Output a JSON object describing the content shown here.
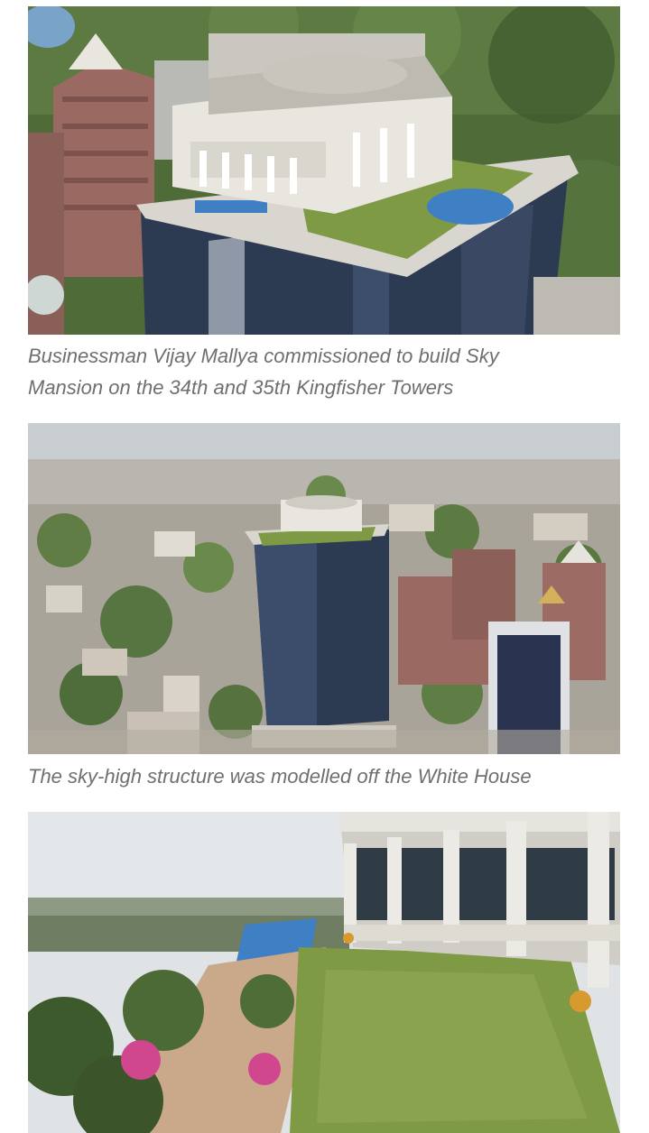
{
  "article": {
    "figures": [
      {
        "caption_lines": [
          "Businessman Vijay Mallya commissioned to build Sky",
          "Mansion on the 34th and 35th Kingfisher Towers"
        ]
      },
      {
        "caption_lines": [
          "The sky-high structure was modelled off the White House"
        ]
      },
      {
        "caption_lines": []
      }
    ]
  },
  "colors": {
    "caption_text": "#6f6f6f",
    "page_background": "#ffffff",
    "foliage": "#4f6b38",
    "glass_tower": "#2c3a52",
    "mansion_white": "#e8e6df",
    "pool_blue": "#3f7fc4",
    "lawn_green": "#7f9a45",
    "brick_tower": "#9a6a62",
    "sky_haze": "#dfe3e6"
  }
}
